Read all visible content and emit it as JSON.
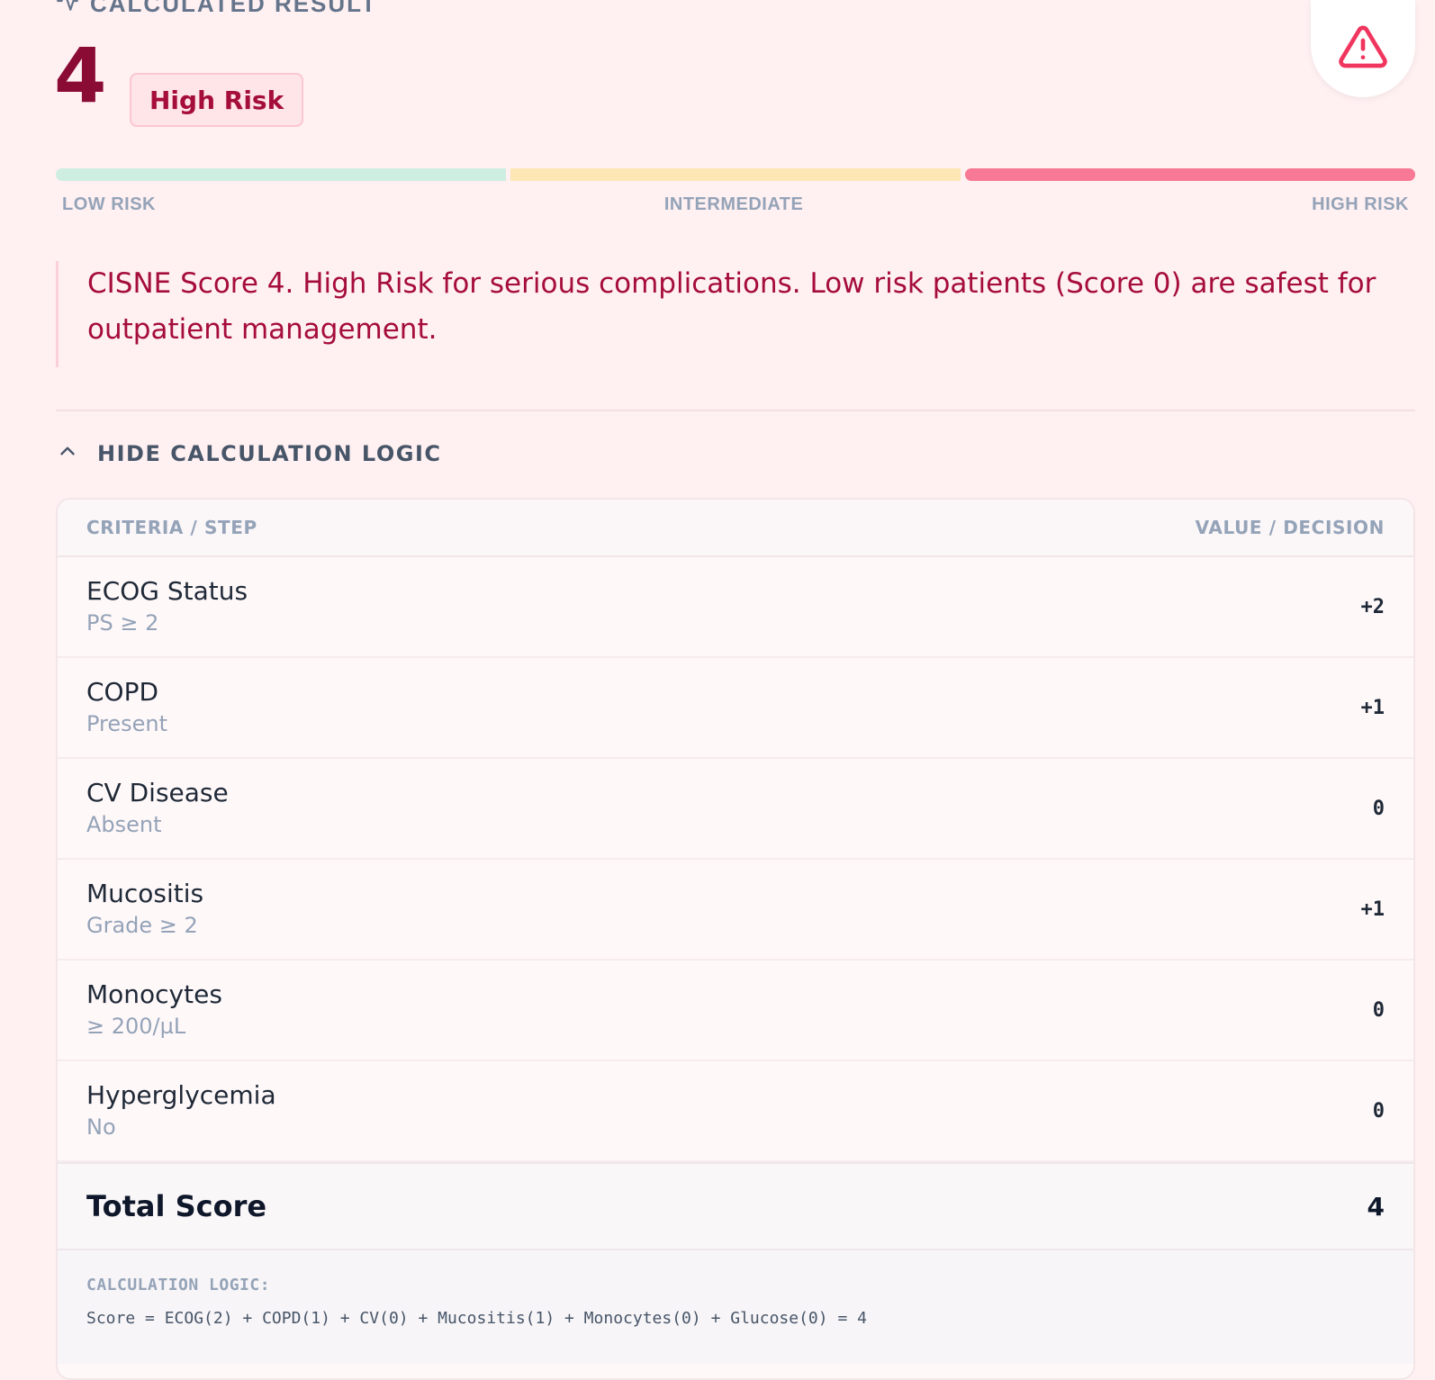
{
  "header": {
    "result_label": "CALCULATED RESULT",
    "score": "4",
    "risk_badge": "High Risk"
  },
  "risk_scale": {
    "labels": [
      "LOW RISK",
      "INTERMEDIATE",
      "HIGH RISK"
    ],
    "active_segment": "HIGH RISK",
    "colors": {
      "low": "#cdeee0",
      "intermediate": "#fce7b5",
      "high": "#f87995"
    }
  },
  "interpretation": "CISNE Score 4. High Risk for serious complications. Low risk patients (Score 0) are safest for outpatient management.",
  "logic_toggle": {
    "label": "HIDE CALCULATION LOGIC"
  },
  "table": {
    "columns": [
      "CRITERIA / STEP",
      "VALUE / DECISION"
    ],
    "rows": [
      {
        "name": "ECOG Status",
        "detail": "PS ≥ 2",
        "value": "+2"
      },
      {
        "name": "COPD",
        "detail": "Present",
        "value": "+1"
      },
      {
        "name": "CV Disease",
        "detail": "Absent",
        "value": "0"
      },
      {
        "name": "Mucositis",
        "detail": "Grade ≥ 2",
        "value": "+1"
      },
      {
        "name": "Monocytes",
        "detail": "≥ 200/µL",
        "value": "0"
      },
      {
        "name": "Hyperglycemia",
        "detail": "No",
        "value": "0"
      }
    ],
    "total_label": "Total Score",
    "total_value": "4"
  },
  "calculation_logic": {
    "heading": "CALCULATION LOGIC:",
    "formula": "Score = ECOG(2) + COPD(1) + CV(0) + Mucositis(1) + Monocytes(0) + Glucose(0) = 4"
  },
  "theme": {
    "accent": "#a50d3a",
    "score_color": "#8a0b34",
    "background": "#fff0f1"
  }
}
